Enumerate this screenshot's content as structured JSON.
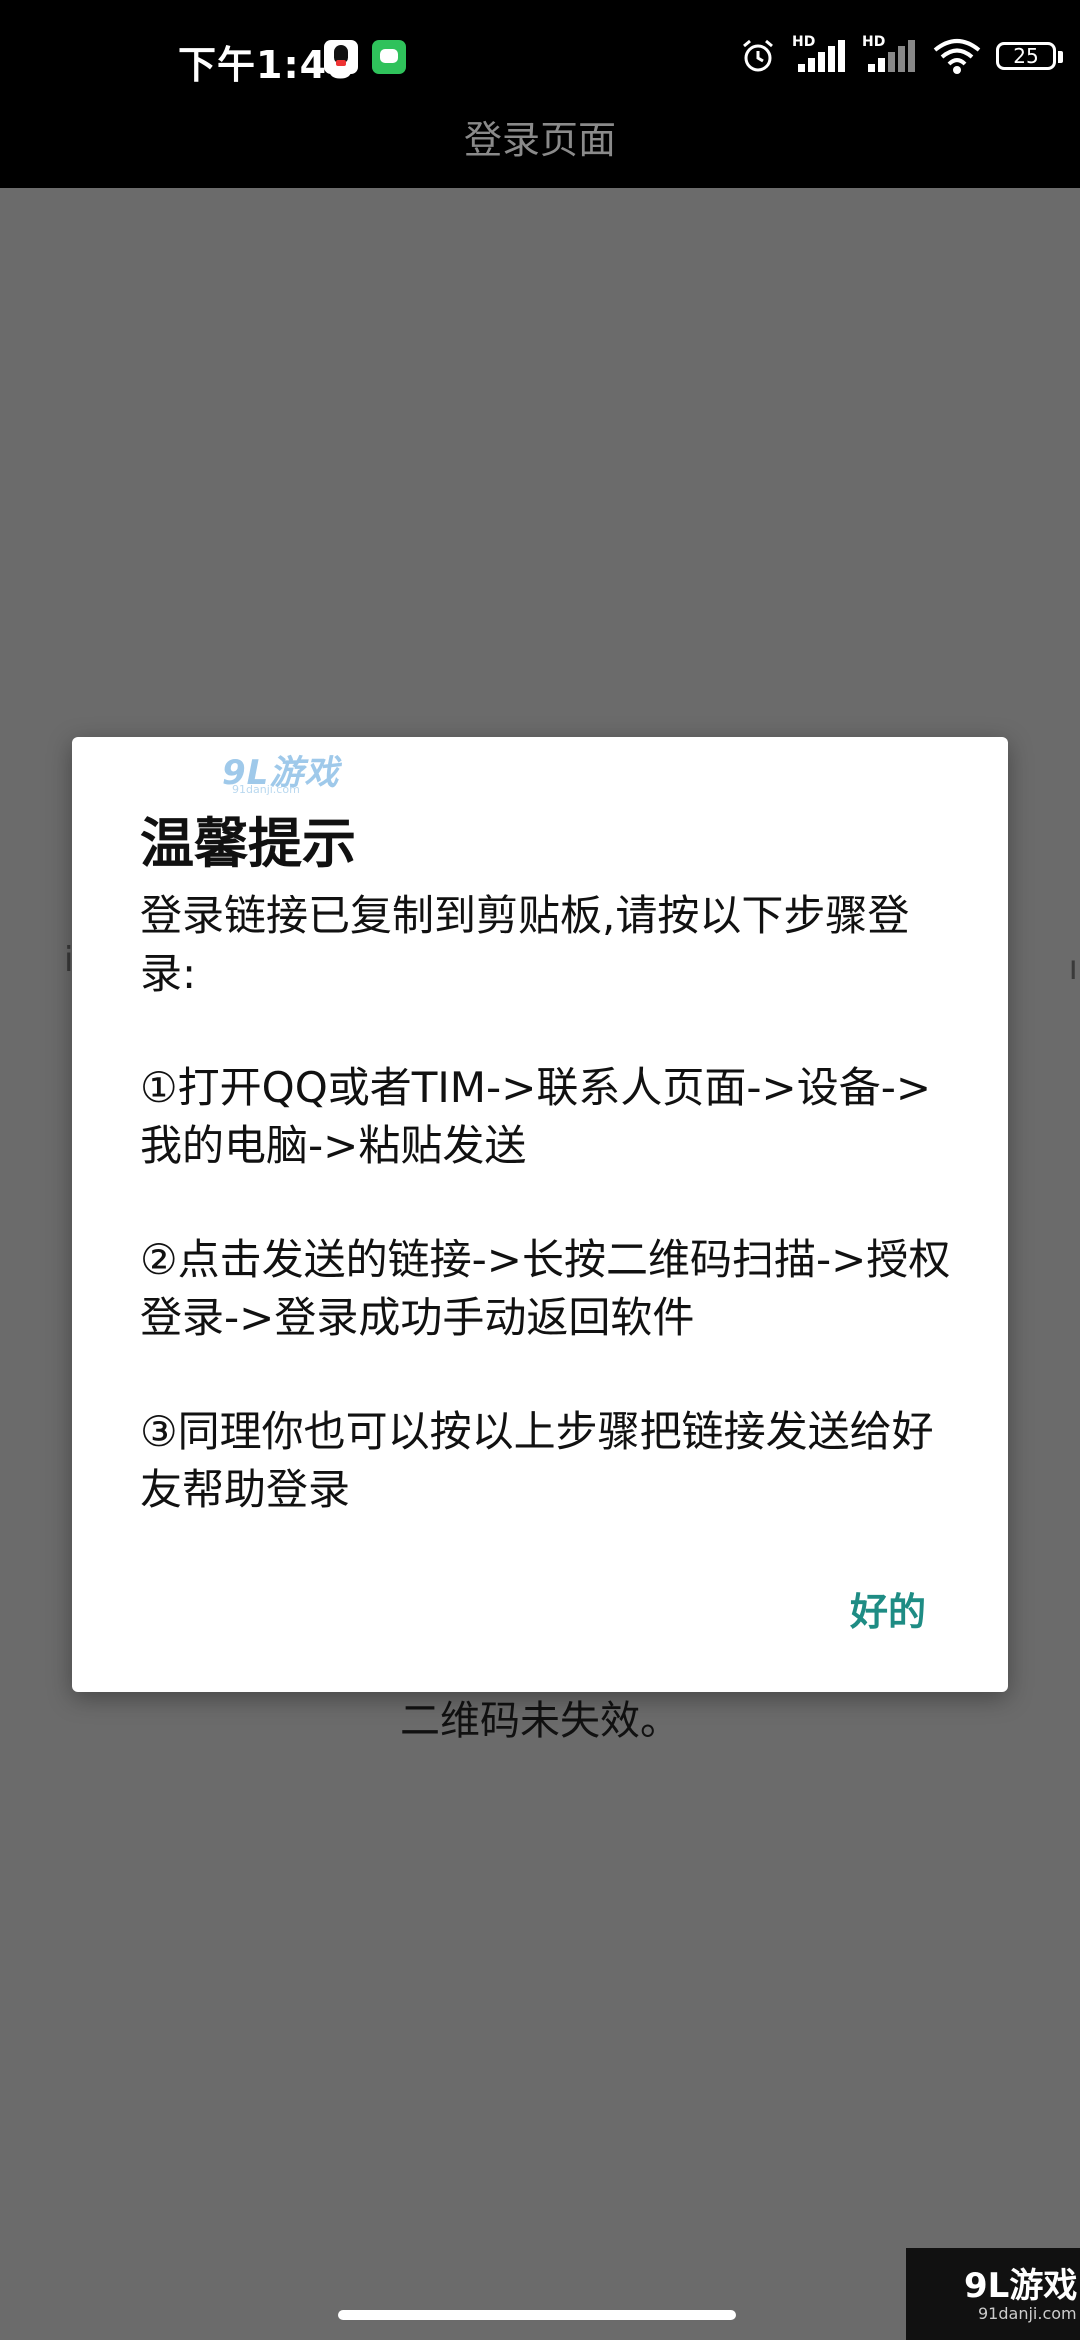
{
  "status_bar": {
    "time": "下午1:48",
    "battery_level": "25",
    "sim1_label": "HD",
    "sim2_label": "HD",
    "icons": [
      "qq-icon",
      "message-icon",
      "alarm-icon",
      "signal-icon",
      "signal-icon",
      "wifi-icon",
      "battery-icon"
    ]
  },
  "app_bar": {
    "title": "登录页面"
  },
  "background": {
    "left_fragment": "i",
    "right_fragment": "ı",
    "qr_notice": "二维码未失效。"
  },
  "dialog": {
    "watermark": "9L游戏",
    "watermark_sub": "91danji.com",
    "title": "温馨提示",
    "paragraphs": [
      "登录链接已复制到剪贴板,请按以下步骤登录:",
      "①打开QQ或者TIM->联系人页面->设备->我的电脑->粘贴发送",
      "②点击发送的链接->长按二维码扫描->授权登录->登录成功手动返回软件",
      "③同理你也可以按以上步骤把链接发送给好友帮助登录"
    ],
    "ok_label": "好的",
    "accent_color": "#1e8c84"
  },
  "corner_logo": {
    "brand": "9L游戏",
    "url": "91danji.com"
  }
}
